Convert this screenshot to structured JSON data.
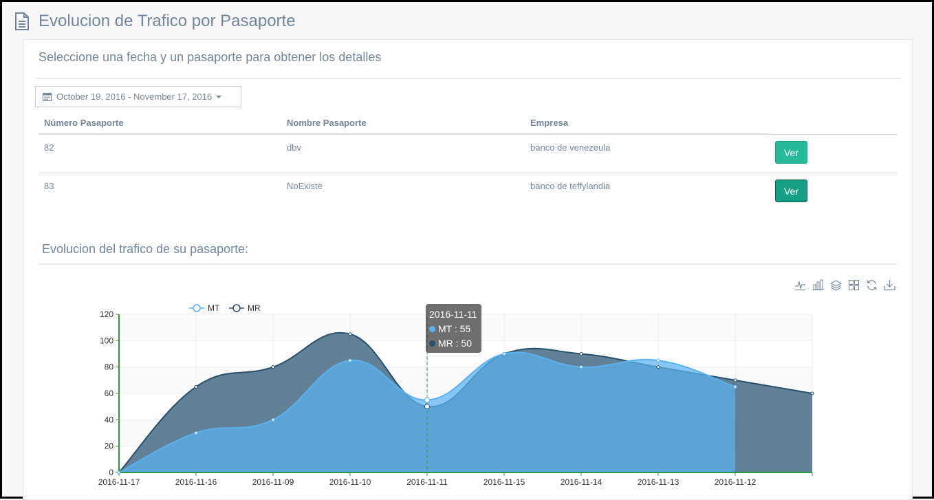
{
  "page": {
    "title": "Evolucion de Trafico por Pasaporte"
  },
  "panel": {
    "subtitle": "Seleccione una fecha y un pasaporte para obtener los detalles",
    "daterange": "October 19, 2016 - November 17, 2016"
  },
  "table": {
    "headers": [
      "Número Pasaporte",
      "Nombre Pasaporte",
      "Empresa"
    ],
    "rows": [
      {
        "numero": "82",
        "nombre": "dbv",
        "empresa": "banco de venezeula",
        "button": "Ver"
      },
      {
        "numero": "83",
        "nombre": "NoExiste",
        "empresa": "banco de teffylandia",
        "button": "Ver"
      }
    ]
  },
  "chart_section": {
    "title": "Evolucion del trafico de su pasaporte:"
  },
  "toolbox": [
    "line-chart-icon",
    "bar-chart-icon",
    "stack-icon",
    "tiled-icon",
    "restore-icon",
    "save-image-icon"
  ],
  "colors": {
    "MT": "#5ab1ef",
    "MR": "#26506e",
    "accent": "#26b99a"
  },
  "tooltip": {
    "title": "2016-11-11",
    "mt": "MT : 55",
    "mr": "MR : 50"
  },
  "chart_data": {
    "type": "area",
    "categories": [
      "2016-11-17",
      "2016-11-16",
      "2016-11-09",
      "2016-11-10",
      "2016-11-11",
      "2016-11-15",
      "2016-11-14",
      "2016-11-13",
      "2016-11-12",
      ""
    ],
    "series": [
      {
        "name": "MT",
        "values": [
          0,
          30,
          40,
          85,
          55,
          90,
          80,
          85,
          65,
          null
        ]
      },
      {
        "name": "MR",
        "values": [
          0,
          65,
          80,
          105,
          50,
          90,
          90,
          80,
          70,
          60
        ]
      }
    ],
    "ylim": [
      0,
      120
    ],
    "yticks": [
      0,
      20,
      40,
      60,
      80,
      100,
      120
    ],
    "grid": true,
    "legend": "top-left"
  }
}
